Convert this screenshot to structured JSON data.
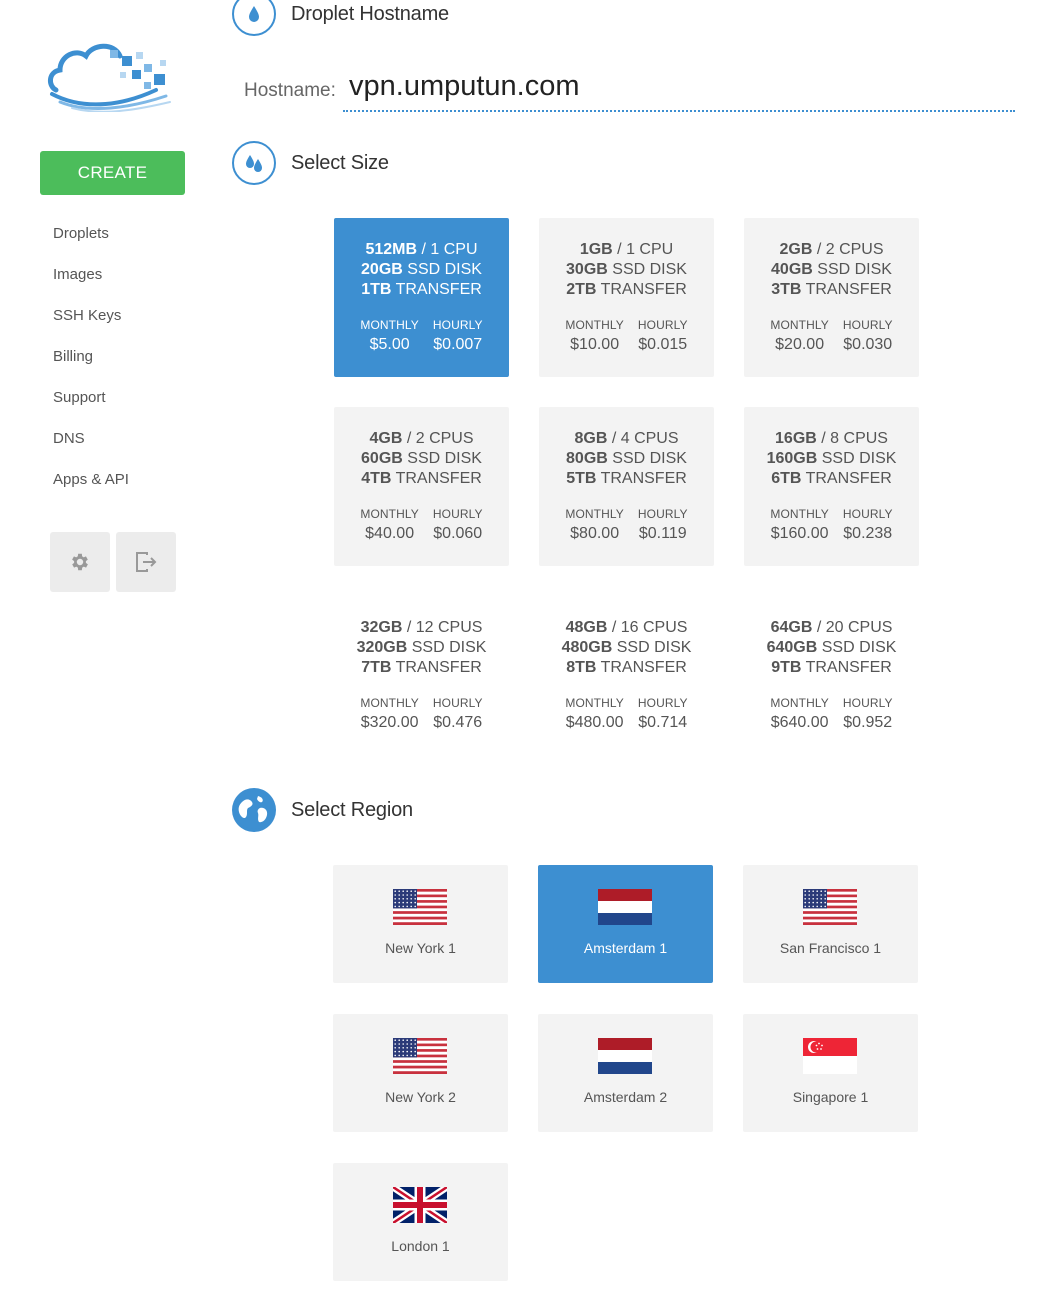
{
  "sidebar": {
    "create_label": "CREATE",
    "nav": [
      "Droplets",
      "Images",
      "SSH Keys",
      "Billing",
      "Support",
      "DNS",
      "Apps & API"
    ]
  },
  "hostname": {
    "heading": "Droplet Hostname",
    "label": "Hostname:",
    "value": "vpn.umputun.com"
  },
  "size": {
    "heading": "Select Size",
    "monthly_label": "MONTHLY",
    "hourly_label": "HOURLY",
    "selected_index": 0,
    "plans": [
      {
        "ram": "512MB",
        "cpu": "1 CPU",
        "disk": "20GB",
        "transfer": "1TB",
        "monthly": "$5.00",
        "hourly": "$0.007"
      },
      {
        "ram": "1GB",
        "cpu": "1 CPU",
        "disk": "30GB",
        "transfer": "2TB",
        "monthly": "$10.00",
        "hourly": "$0.015"
      },
      {
        "ram": "2GB",
        "cpu": "2 CPUS",
        "disk": "40GB",
        "transfer": "3TB",
        "monthly": "$20.00",
        "hourly": "$0.030"
      },
      {
        "ram": "4GB",
        "cpu": "2 CPUS",
        "disk": "60GB",
        "transfer": "4TB",
        "monthly": "$40.00",
        "hourly": "$0.060"
      },
      {
        "ram": "8GB",
        "cpu": "4 CPUS",
        "disk": "80GB",
        "transfer": "5TB",
        "monthly": "$80.00",
        "hourly": "$0.119"
      },
      {
        "ram": "16GB",
        "cpu": "8 CPUS",
        "disk": "160GB",
        "transfer": "6TB",
        "monthly": "$160.00",
        "hourly": "$0.238"
      },
      {
        "ram": "32GB",
        "cpu": "12 CPUS",
        "disk": "320GB",
        "transfer": "7TB",
        "monthly": "$320.00",
        "hourly": "$0.476"
      },
      {
        "ram": "48GB",
        "cpu": "16 CPUS",
        "disk": "480GB",
        "transfer": "8TB",
        "monthly": "$480.00",
        "hourly": "$0.714"
      },
      {
        "ram": "64GB",
        "cpu": "20 CPUS",
        "disk": "640GB",
        "transfer": "9TB",
        "monthly": "$640.00",
        "hourly": "$0.952"
      }
    ],
    "disk_suffix": "SSD DISK",
    "transfer_suffix": "TRANSFER"
  },
  "region": {
    "heading": "Select Region",
    "selected_index": 1,
    "regions": [
      {
        "name": "New York 1",
        "flag": "us-flag-icon"
      },
      {
        "name": "Amsterdam 1",
        "flag": "nl-flag-icon"
      },
      {
        "name": "San Francisco 1",
        "flag": "us-flag-icon"
      },
      {
        "name": "New York 2",
        "flag": "us-flag-icon"
      },
      {
        "name": "Amsterdam 2",
        "flag": "nl-flag-icon"
      },
      {
        "name": "Singapore 1",
        "flag": "sg-flag-icon"
      },
      {
        "name": "London 1",
        "flag": "uk-flag-icon"
      }
    ]
  },
  "colors": {
    "accent": "#3d8fd1",
    "create": "#4cbd5b",
    "card": "#f3f3f3"
  }
}
